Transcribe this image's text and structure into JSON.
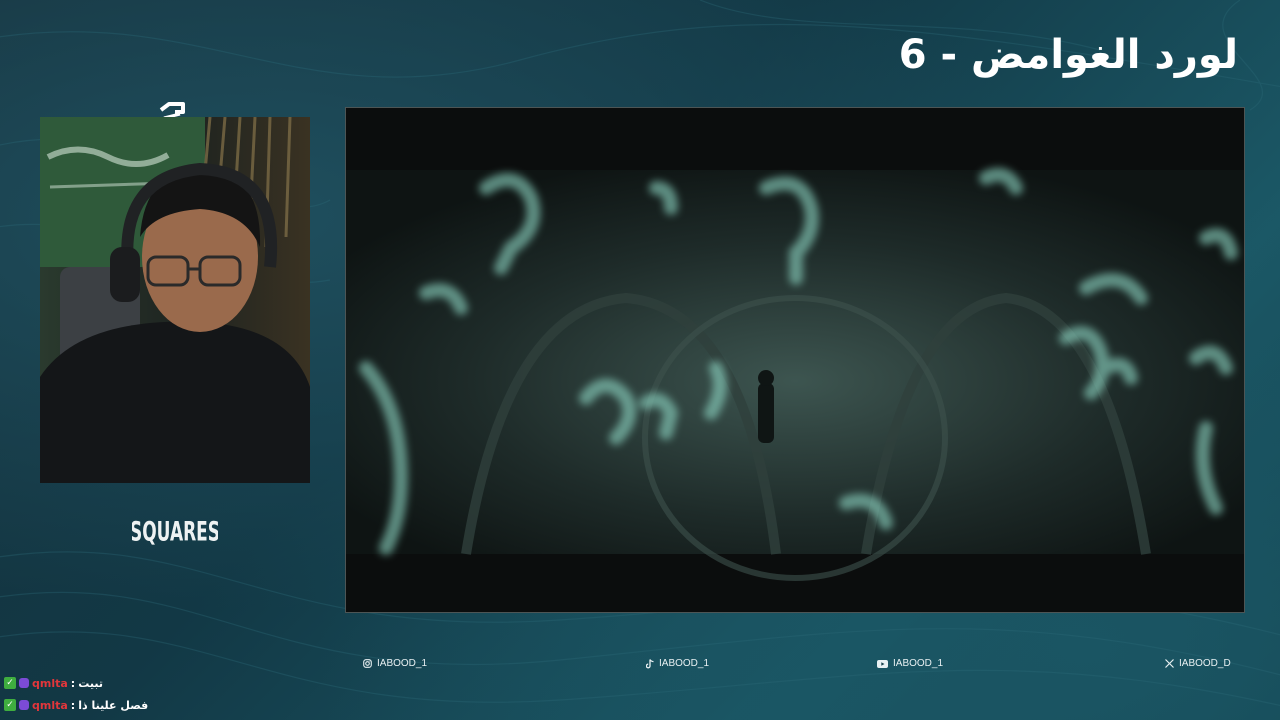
{
  "overlay": {
    "title": "لورد الغوامض - 6",
    "brand": {
      "logo": "squares-logo-icon",
      "wordmark": "SQUARES"
    }
  },
  "socials": [
    {
      "icon": "instagram-icon",
      "handle": "IABOOD_1"
    },
    {
      "icon": "tiktok-icon",
      "handle": "IABOOD_1"
    },
    {
      "icon": "youtube-icon",
      "handle": "IABOOD_1"
    },
    {
      "icon": "x-icon",
      "handle": "IABOOD_D"
    }
  ],
  "chat": [
    {
      "user": "qmlta",
      "separator": ":",
      "message": "تبيت"
    },
    {
      "user": "qmlta",
      "separator": ":",
      "message": "فصل علينا ذا"
    }
  ],
  "colors": {
    "accent": "#f2f2f2",
    "username": "#e2363b",
    "check": "#3fae3f",
    "badge": "#7b4bd6",
    "glyph_glow": "#8fd9c6"
  }
}
